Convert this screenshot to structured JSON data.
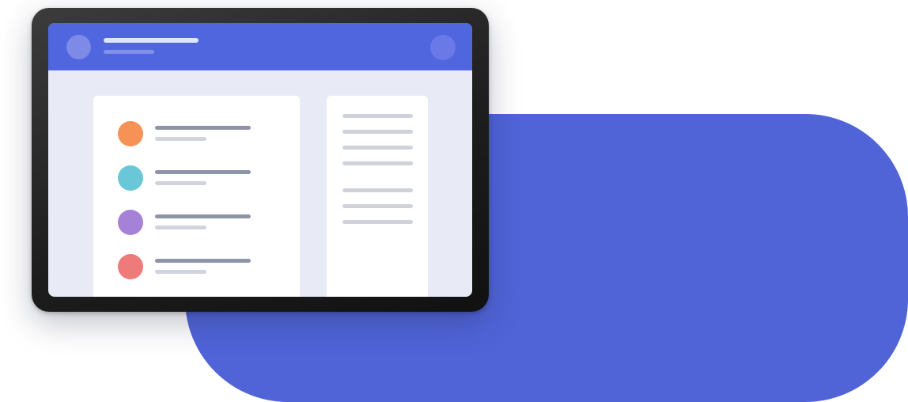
{
  "colors": {
    "background": "#ffffff",
    "accent_blob": "#5064d8",
    "device_bezel": "#262626",
    "screen_bg": "#e8eaf5",
    "header": "#5066df",
    "header_avatar": "#7d8ae8",
    "header_action": "#6a79e5",
    "header_title_line": "#dfe4ff",
    "header_subtitle_line": "#8391ea",
    "card": "#ffffff",
    "text_line_primary": "#8e94a8",
    "text_line_secondary": "#d1d4de",
    "side_line": "#cfd2da"
  },
  "list_items": [
    {
      "avatar_color": "#f79256"
    },
    {
      "avatar_color": "#6ac7d8"
    },
    {
      "avatar_color": "#a681d8"
    },
    {
      "avatar_color": "#ee7a7a"
    }
  ],
  "side_panel": {
    "group_1_line_count": 4,
    "group_2_line_count": 3
  }
}
